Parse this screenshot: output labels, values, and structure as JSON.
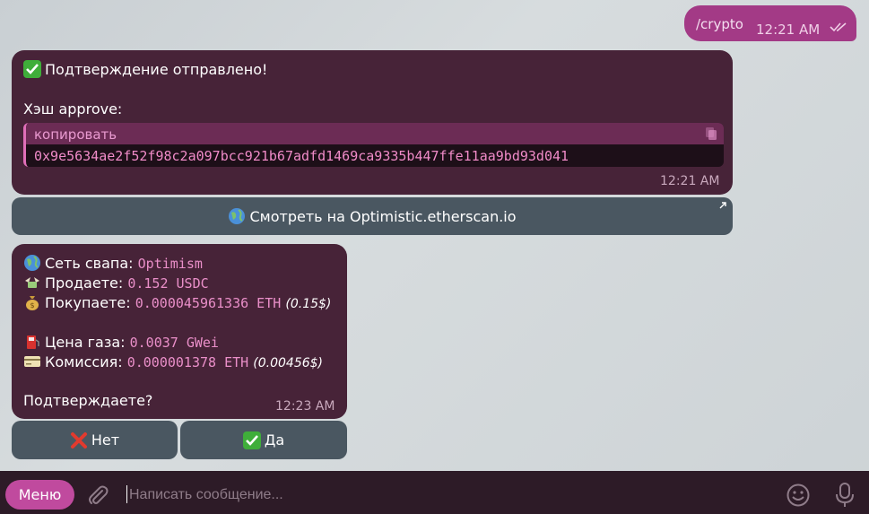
{
  "outgoing": {
    "text": "/crypto",
    "time": "12:21 AM"
  },
  "msg1": {
    "title": "Подтверждение отправлено!",
    "hash_label": "Хэш approve:",
    "code_label": "копировать",
    "hash": "0x9e5634ae2f52f98c2a097bcc921b67adfd1469ca9335b447ffe11aa9bd93d041",
    "time": "12:21 AM",
    "link_button": "Смотреть на Optimistic.etherscan.io"
  },
  "msg2": {
    "network_label": "Сеть свапа:",
    "network_value": "Optimism",
    "sell_label": "Продаете:",
    "sell_value": "0.152 USDC",
    "buy_label": "Покупаете:",
    "buy_value": "0.000045961336 ETH",
    "buy_usd": "(0.15$)",
    "gas_label": "Цена газа:",
    "gas_value": "0.0037 GWei",
    "fee_label": "Комиссия:",
    "fee_value": "0.000001378 ETH",
    "fee_usd": "(0.00456$)",
    "question": "Подтверждаете?",
    "time": "12:23 AM",
    "no_button": "Нет",
    "yes_button": "Да"
  },
  "composer": {
    "menu_label": "Меню",
    "placeholder": "Написать сообщение..."
  },
  "colors": {
    "accent": "#c04a9e",
    "bubble": "#472338",
    "button": "#4a5761"
  }
}
